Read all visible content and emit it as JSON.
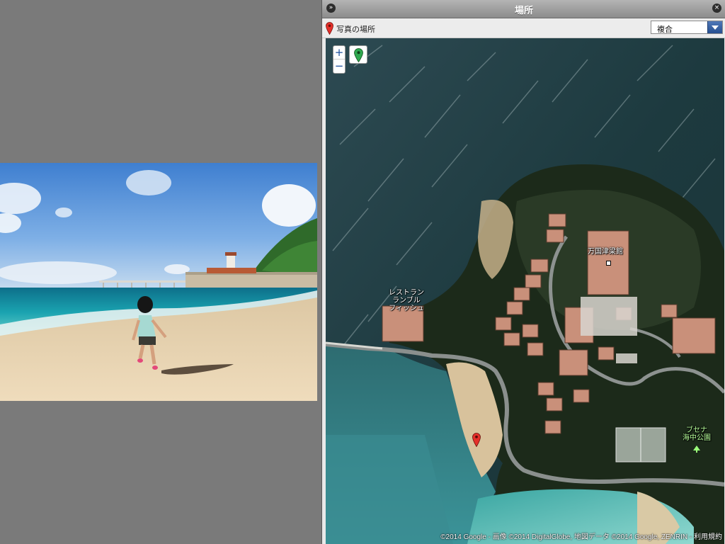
{
  "panel": {
    "title": "場所",
    "collapse_icon": "double-chevron-right-icon",
    "close_icon": "close-icon"
  },
  "toolbar": {
    "label": "写真の場所",
    "pin_icon": "map-pin-icon",
    "map_type_selected": "複合"
  },
  "map": {
    "zoom_in": "+",
    "zoom_out": "−",
    "labels": {
      "hotel": "万国津梁館",
      "restaurant_line1": "レストラン",
      "restaurant_line2": "ランブル",
      "restaurant_line3": "フィッシュ",
      "park_line1": "ブセナ",
      "park_line2": "海中公園"
    },
    "copyright": "©2014 Google - 画像 ©2014 DigitalGlobe, 地図データ ©2014 Google, ZENRIN - ",
    "terms": "利用規約"
  },
  "colors": {
    "marker_red": "#e5302a",
    "pin_green": "#2fa84f",
    "map_type_button": "#2d5aa0"
  }
}
